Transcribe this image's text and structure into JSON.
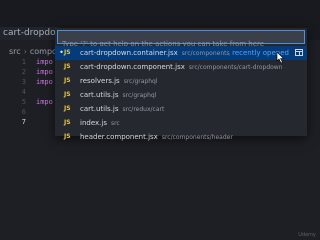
{
  "editor": {
    "tab_label": "cart-dropdown.",
    "breadcrumb": [
      "src",
      "compon"
    ],
    "line_numbers": [
      "1",
      "2",
      "3",
      "4",
      "5",
      "6",
      "7"
    ],
    "code_lines": [
      "impo",
      "impo",
      "impo",
      "",
      "impo",
      "",
      ""
    ]
  },
  "quick_open": {
    "placeholder": "Type '?' to get help on the actions you can take from here",
    "items": [
      {
        "icon": "JS",
        "name": "cart-dropdown.container.jsx",
        "path": "src/components/ca...",
        "badge": "recently opened",
        "selected": true
      },
      {
        "icon": "JS",
        "name": "cart-dropdown.component.jsx",
        "path": "src/components/cart-dropdown"
      },
      {
        "icon": "JS",
        "name": "resolvers.js",
        "path": "src/graphql"
      },
      {
        "icon": "JS",
        "name": "cart.utils.js",
        "path": "src/graphql"
      },
      {
        "icon": "JS",
        "name": "cart.utils.js",
        "path": "src/redux/cart"
      },
      {
        "icon": "JS",
        "name": "index.js",
        "path": "src"
      },
      {
        "icon": "JS",
        "name": "header.component.jsx",
        "path": "src/components/header"
      }
    ]
  },
  "watermark": "Udemy"
}
